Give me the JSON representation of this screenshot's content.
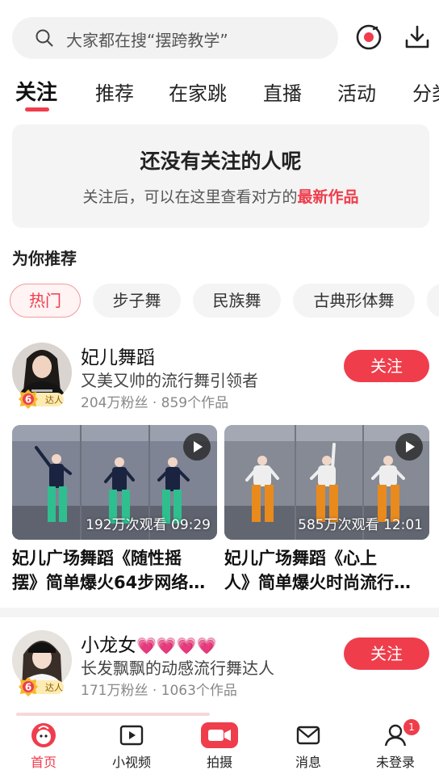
{
  "search": {
    "placeholder": "大家都在搜“摆跨教学”"
  },
  "tabs": [
    {
      "label": "关注"
    },
    {
      "label": "推荐"
    },
    {
      "label": "在家跳"
    },
    {
      "label": "直播"
    },
    {
      "label": "活动"
    },
    {
      "label": "分类"
    }
  ],
  "empty_state": {
    "title": "还没有关注的人呢",
    "subtitle_prefix": "关注后，可以在这里查看对方的",
    "subtitle_highlight": "最新作品"
  },
  "recommend": {
    "title": "为你推荐"
  },
  "chips": [
    {
      "label": "热门"
    },
    {
      "label": "步子舞"
    },
    {
      "label": "民族舞"
    },
    {
      "label": "古典形体舞"
    }
  ],
  "creators": [
    {
      "name": "妃儿舞蹈",
      "desc": "又美又帅的流行舞引领者",
      "meta": "204万粉丝 · 859个作品",
      "badge_level": "6",
      "badge_label": "达人",
      "follow_label": "关注",
      "videos": [
        {
          "stats": "192万次观看 09:29",
          "title_line1": "妃儿广场舞蹈《随性摇",
          "title_line2": "摆》简单爆火64步网络…"
        },
        {
          "stats": "585万次观看 12:01",
          "title_line1": "妃儿广场舞蹈《心上",
          "title_line2": "人》简单爆火时尚流行…"
        }
      ]
    },
    {
      "name": "小龙女",
      "name_hearts": "💗💗💗💗",
      "desc": "长发飘飘的动感流行舞达人",
      "meta": "171万粉丝 · 1063个作品",
      "badge_level": "6",
      "badge_label": "达人",
      "follow_label": "关注"
    }
  ],
  "bottom_nav": [
    {
      "label": "首页",
      "icon": "home-icon"
    },
    {
      "label": "小视频",
      "icon": "short-video-icon"
    },
    {
      "label": "拍摄",
      "icon": "camera-icon"
    },
    {
      "label": "消息",
      "icon": "mail-icon"
    },
    {
      "label": "未登录",
      "icon": "user-icon",
      "badge": "1"
    }
  ],
  "colors": {
    "accent": "#ef3d4c",
    "chip_bg": "#f4f4f4",
    "badge_gold": "#f5b731"
  }
}
